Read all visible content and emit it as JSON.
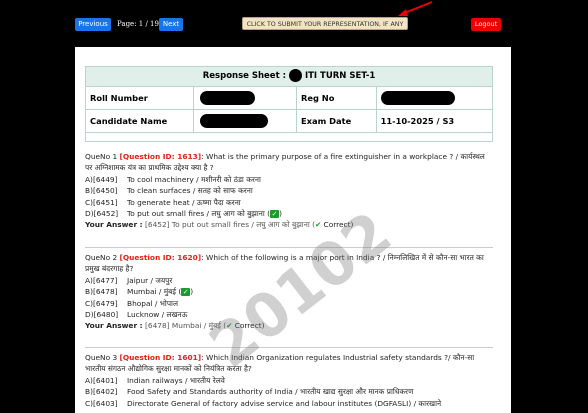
{
  "topbar": {
    "previous": "Previous",
    "page": "Page: 1 / 19",
    "next": "Next",
    "submit": "CLICK TO SUBMIT YOUR REPRESENTATION, IF ANY",
    "logout": "Logout"
  },
  "sheet": {
    "title_prefix": "Response Sheet :",
    "title_suffix": "ITI TURN SET-1",
    "roll_label": "Roll Number",
    "reg_label": "Reg No",
    "name_label": "Candidate Name",
    "date_label": "Exam Date",
    "date_value": "11-10-2025 / S3"
  },
  "questions": [
    {
      "prefix": "QueNo 1 ",
      "qid": "[Question ID: 1613]",
      "text": ": What is the primary purpose of a fire extinguisher in a workplace ? / कार्यस्थल पर अग्निशामक यंत्र का प्राथमिक उद्देश्य क्या है ?",
      "options": [
        {
          "code": "A)[6449]",
          "text": "To cool machinery / मशीनरी को ठंडा करना"
        },
        {
          "code": "B)[6450]",
          "text": "To clean surfaces / सतह को साफ करना"
        },
        {
          "code": "C)[6451]",
          "text": "To generate heat / ऊष्मा पैदा करना"
        },
        {
          "code": "D)[6452]",
          "text": "To put out small fires / लघु आग को बुझाना ("
        }
      ],
      "answer_label": "Your Answer :",
      "answer_value": "[6452] To put out small fires / लघु आग को बुझाना (",
      "correct": "Correct)"
    },
    {
      "prefix": "QueNo 2 ",
      "qid": "[Question ID: 1620]",
      "text": ": Which of the following is a major port in India ? / निम्नलिखित में से कौन-सा भारत का प्रमुख बंदरगाह है?",
      "options": [
        {
          "code": "A)[6477]",
          "text": "Jaipur / जयपुर"
        },
        {
          "code": "B)[6478]",
          "text": "Mumbai / मुंबई ("
        },
        {
          "code": "C)[6479]",
          "text": "Bhopal / भोपाल"
        },
        {
          "code": "D)[6480]",
          "text": "Lucknow / लखनऊ"
        }
      ],
      "answer_label": "Your Answer :",
      "answer_value": "[6478] Mumbai / मुंबई (",
      "correct": "Correct)"
    },
    {
      "prefix": "QueNo 3 ",
      "qid": "[Question ID: 1601]",
      "text": ": Which Indian Organization regulates Industrial safety standards ?/ कौन-सा भारतीय संगठन औद्योगिक सुरक्षा मानकों को नियंत्रित करता है?",
      "options": [
        {
          "code": "A)[6401]",
          "text": "Indian railways / भारतीय रेलवे"
        },
        {
          "code": "B)[6402]",
          "text": "Food Safety and Standards authority of India / भारतीय खाद्य सुरक्षा और मानक प्राधिकरण"
        },
        {
          "code": "C)[6403]",
          "text": "Directorate General of factory advise service and labour institutes (DGFASLI) / कारखाने"
        }
      ]
    }
  ],
  "watermark": "20102",
  "icons": {
    "check_box": "check-box-icon",
    "tick": "check-mark-icon",
    "arrow": "red-arrow-icon"
  }
}
